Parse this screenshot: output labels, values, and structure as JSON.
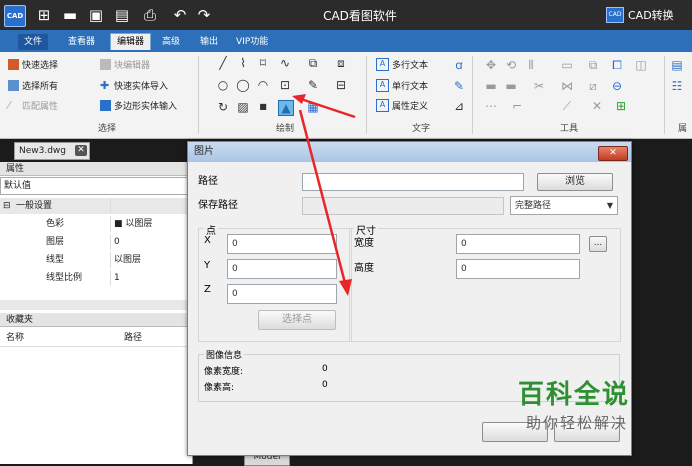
{
  "app": {
    "title": "CAD看图软件",
    "logo_text": "CAD",
    "brand": "CAD转换",
    "brand_logo": "CAD",
    "title_icons": [
      "new-icon",
      "open-icon",
      "save-icon",
      "save-as-icon",
      "print-icon",
      "undo-icon",
      "redo-icon"
    ]
  },
  "menu": {
    "tabs": [
      {
        "label": "文件",
        "key": "file"
      },
      {
        "label": "查看器",
        "key": "viewer"
      },
      {
        "label": "编辑器",
        "key": "editor"
      },
      {
        "label": "高级",
        "key": "advanced"
      },
      {
        "label": "输出",
        "key": "output"
      },
      {
        "label": "VIP功能",
        "key": "vip"
      }
    ],
    "active": "编辑器"
  },
  "ribbon": {
    "select_group": {
      "label": "选择",
      "items": [
        "快速选择",
        "块编辑器",
        "选择所有",
        "快速实体导入",
        "匹配属性",
        "多边形实体输入"
      ]
    },
    "draw_group": {
      "label": "绘制"
    },
    "text_group": {
      "label": "文字",
      "items": [
        "多行文本",
        "单行文本",
        "属性定义"
      ]
    },
    "tools_group": {
      "label": "工具"
    },
    "attr_group_label": "属"
  },
  "document_tab": {
    "name": "New3.dwg"
  },
  "properties": {
    "header": "属性",
    "default_value": "默认值",
    "section": "一般设置",
    "rows": [
      {
        "key": "色彩",
        "value": "■ 以图层"
      },
      {
        "key": "图层",
        "value": "0"
      },
      {
        "key": "线型",
        "value": "以图层"
      },
      {
        "key": "线型比例",
        "value": "1"
      }
    ]
  },
  "favorites": {
    "header": "收藏夹",
    "columns": [
      "名称",
      "路径"
    ]
  },
  "dialog": {
    "title": "图片",
    "path_label": "路径",
    "path_value": "",
    "browse_button": "浏览",
    "save_path_label": "保存路径",
    "path_mode": "完整路径",
    "point_group": "点",
    "x_label": "X",
    "x_value": "0",
    "y_label": "Y",
    "y_value": "0",
    "z_label": "Z",
    "z_value": "0",
    "pick_point_button": "选择点",
    "size_group": "尺寸",
    "width_label": "宽度",
    "width_value": "0",
    "height_label": "高度",
    "height_value": "0",
    "more_button": "...",
    "image_info_title": "图像信息",
    "pixel_width_label": "像素宽度:",
    "pixel_width_value": "0",
    "pixel_height_label": "像素高:",
    "pixel_height_value": "0"
  },
  "watermark": {
    "title": "百科全说",
    "subtitle": "助你轻松解决"
  },
  "model_tab": "Model"
}
